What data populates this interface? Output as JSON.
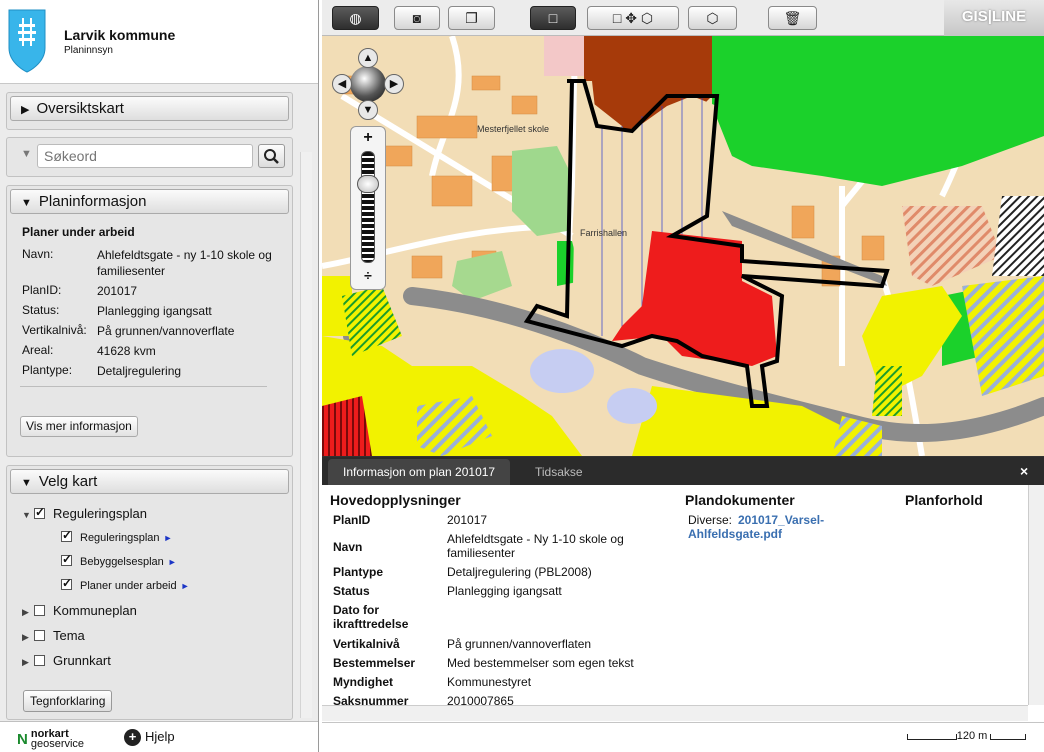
{
  "header": {
    "title": "Larvik kommune",
    "subtitle": "Planinnsyn"
  },
  "panels": {
    "oversikt": "Oversiktskart",
    "sok_placeholder": "Søkeord",
    "planinfo_title": "Planinformasjon",
    "velg_title": "Velg kart"
  },
  "plan": {
    "heading": "Planer under arbeid",
    "rows": [
      {
        "k": "Navn:",
        "v": "Ahlefeldtsgate - ny 1-10 skole og familiesenter"
      },
      {
        "k": "PlanID:",
        "v": "201017"
      },
      {
        "k": "Status:",
        "v": "Planlegging igangsatt"
      },
      {
        "k": "Vertikalnivå:",
        "v": "På grunnen/vannoverflate"
      },
      {
        "k": "Areal:",
        "v": "41628 kvm"
      },
      {
        "k": "Plantype:",
        "v": "Detaljregulering"
      }
    ],
    "more_button": "Vis mer informasjon"
  },
  "layers": {
    "reguleringsplan": "Reguleringsplan",
    "sub": [
      "Reguleringsplan",
      "Bebyggelsesplan",
      "Planer under arbeid"
    ],
    "kommuneplan": "Kommuneplan",
    "tema": "Tema",
    "grunnkart": "Grunnkart",
    "legend_button": "Tegnforklaring"
  },
  "footer": {
    "logo1": "norkart",
    "logo2": "geoservice",
    "help": "Hjelp"
  },
  "toolbar": {
    "brand": "GIS|LINE"
  },
  "map_labels": {
    "school": "Mesterfjellet skole",
    "hall": "Farrishallen"
  },
  "info": {
    "tab1": "Informasjon om plan 201017",
    "tab2": "Tidsakse",
    "close": "×",
    "h_main": "Hovedopplysninger",
    "h_docs": "Plandokumenter",
    "h_rel": "Planforhold",
    "rows": [
      {
        "k": "PlanID",
        "v": "201017"
      },
      {
        "k": "Navn",
        "v": "Ahlefeldtsgate - Ny 1-10 skole og familiesenter"
      },
      {
        "k": "Plantype",
        "v": "Detaljregulering (PBL2008)"
      },
      {
        "k": "Status",
        "v": "Planlegging igangsatt"
      },
      {
        "k": "Dato for ikrafttredelse",
        "v": ""
      },
      {
        "k": "Vertikalnivå",
        "v": "På grunnen/vannoverflaten"
      },
      {
        "k": "Bestemmelser",
        "v": "Med bestemmelser som egen tekst"
      },
      {
        "k": "Myndighet",
        "v": "Kommunestyret"
      },
      {
        "k": "Saksnummer",
        "v": "2010007865"
      }
    ],
    "doc_label": "Diverse:",
    "doc_link": "201017_Varsel-Ahlfeldsgate.pdf"
  },
  "scale": {
    "label": "120 m"
  },
  "colors": {
    "red": "#ee1c1c",
    "green": "#1bd12b",
    "yellow": "#f2f200",
    "brown": "#a63a0a",
    "road": "#8c8c8c"
  }
}
